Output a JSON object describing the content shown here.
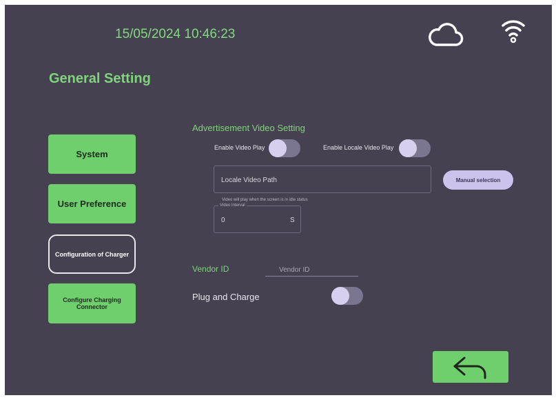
{
  "status_bar": {
    "datetime": "15/05/2024 10:46:23",
    "icons": [
      "cloud-icon",
      "wifi-icon"
    ]
  },
  "page": {
    "title": "General Setting"
  },
  "sidebar": {
    "items": [
      {
        "label": "System",
        "active": false
      },
      {
        "label": "User Preference",
        "active": false
      },
      {
        "label": "Configuration of Charger",
        "active": true
      },
      {
        "label": "Configure Charging Connector",
        "active": false
      }
    ]
  },
  "ad_video": {
    "section_title": "Advertisement Video Setting",
    "enable_video_label": "Enable Video Play",
    "enable_video_on": false,
    "enable_local_label": "Enable Locale Video Play",
    "enable_local_on": false,
    "path_placeholder": "Locale Video Path",
    "manual_label": "Manual selection",
    "hint": "Video will play when the screen is in idle status",
    "interval_label": "Video Interval",
    "interval_value": "0",
    "interval_unit": "S"
  },
  "vendor": {
    "label": "Vendor ID",
    "placeholder": "Vendor ID"
  },
  "plug_charge": {
    "label": "Plug and Charge",
    "on": false
  },
  "colors": {
    "background": "#454150",
    "accent": "#6ecf6c",
    "accent_text": "#7fd47c",
    "toggle_knob": "#d6cfee"
  },
  "footer": {
    "back_icon": "back-arrow-icon"
  }
}
